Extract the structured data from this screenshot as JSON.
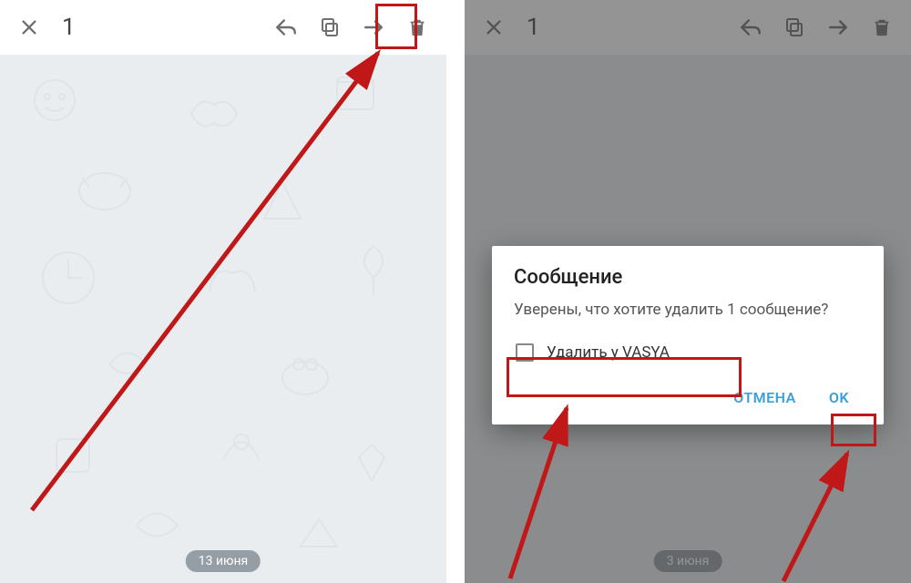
{
  "left": {
    "toolbar": {
      "count": "1"
    },
    "date_chip": "13 июня"
  },
  "right": {
    "toolbar": {
      "count": "1"
    },
    "date_chip": "3 июня",
    "dialog": {
      "title": "Сообщение",
      "message": "Уверены, что хотите удалить 1 сообщение?",
      "checkbox_label": "Удалить у VASYA",
      "cancel": "ОТМЕНА",
      "ok": "OK"
    }
  }
}
